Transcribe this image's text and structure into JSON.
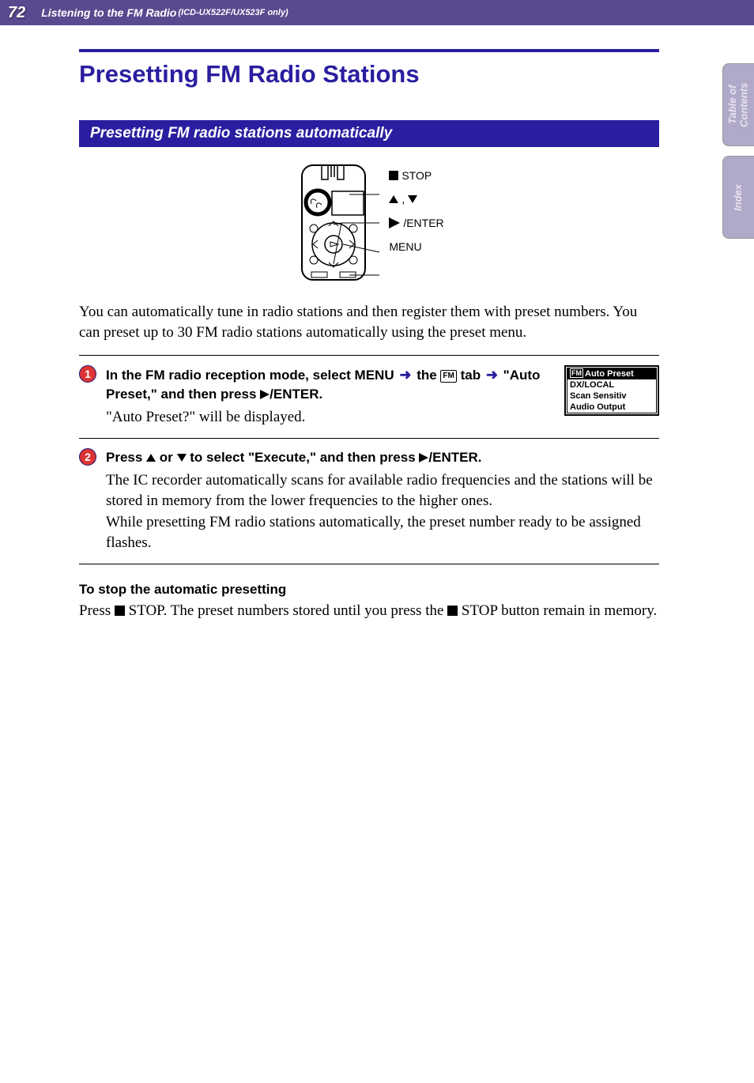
{
  "header": {
    "page_number": "72",
    "title": "Listening to the FM Radio",
    "subtitle": "(ICD-UX522F/UX523F only)"
  },
  "side_tabs": {
    "toc": "Table of Contents",
    "index": "Index"
  },
  "main_heading": "Presetting FM Radio Stations",
  "sub_heading": "Presetting FM radio stations automatically",
  "device_labels": {
    "stop": "STOP",
    "updown_sep": ",",
    "enter": "/ENTER",
    "menu": "MENU"
  },
  "intro_text": "You can automatically tune in radio stations and then register them with preset numbers. You can preset up to 30 FM radio stations automatically using the preset menu.",
  "steps": [
    {
      "num": "1",
      "title_parts": {
        "a": "In the FM radio reception mode, select MENU",
        "b": "the",
        "fm_icon": "FM",
        "c": "tab",
        "d": "\"Auto Preset,\" and then press",
        "e": "/ENTER."
      },
      "text": "\"Auto Preset?\" will be displayed.",
      "menu": {
        "icon": "FM",
        "items": [
          "Auto Preset",
          "DX/LOCAL",
          "Scan Sensitiv",
          "Audio Output"
        ],
        "highlighted": 0
      }
    },
    {
      "num": "2",
      "title_parts": {
        "a": "Press",
        "b": "or",
        "c": "to select \"Execute,\" and then press",
        "d": "/ENTER."
      },
      "text": "The IC recorder automatically scans for available radio frequencies and the stations will be stored in memory from the lower frequencies to the higher ones.\nWhile presetting FM radio stations automatically, the preset number ready to be assigned flashes."
    }
  ],
  "stop_section": {
    "heading": "To stop the automatic presetting",
    "text_a": "Press ",
    "text_b": " STOP. The preset numbers stored until you press the ",
    "text_c": " STOP button remain in memory."
  }
}
